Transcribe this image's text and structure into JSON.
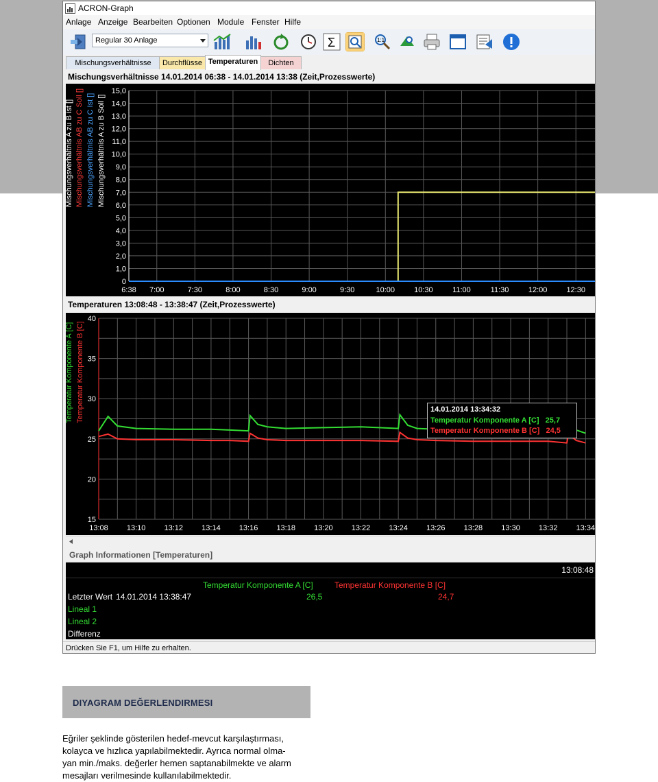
{
  "window": {
    "title": "ACRON-Graph"
  },
  "menu": [
    "Anlage",
    "Anzeige",
    "Bearbeiten",
    "Optionen",
    "Module",
    "Fenster",
    "Hilfe"
  ],
  "toolbar": {
    "select_value": "Regular 30 Anlage",
    "icons": [
      "layout-icon",
      "bar-chart-icon",
      "bar-chart-icon-2",
      "refresh-icon",
      "clock-icon",
      "sum-icon",
      "zoom-fit-icon",
      "zoom-icon",
      "zoom-in-icon",
      "print-icon",
      "window-icon",
      "export-icon",
      "info-icon"
    ]
  },
  "tabs": [
    "Mischungsverhältnisse",
    "Durchflüsse",
    "Temperaturen",
    "Dichten"
  ],
  "active_tab": "Temperaturen",
  "chart1": {
    "title": "Mischungsverhältnisse 14.01.2014 06:38 - 14.01.2014 13:38 (Zeit,Prozesswerte)",
    "axis_labels": [
      {
        "text": "Mischungsverhältnis A zu B ist []",
        "color": "#ffffff"
      },
      {
        "text": "Mischungsverhältnis AB zu C Soll []",
        "color": "#ff3b3b"
      },
      {
        "text": "Mischungsverhältnis AB zu C Ist []",
        "color": "#4aa3ff"
      },
      {
        "text": "Mischungsverhältnis A zu B Soll []",
        "color": "#ffffff"
      }
    ],
    "y_ticks": [
      "15,0",
      "14,0",
      "13,0",
      "12,0",
      "11,0",
      "10,0",
      "9,0",
      "8,0",
      "7,0",
      "6,0",
      "5,0",
      "4,0",
      "3,0",
      "2,0",
      "1,0",
      "0"
    ],
    "x_ticks": [
      "6:38",
      "7:00",
      "7:30",
      "8:00",
      "8:30",
      "9:00",
      "9:30",
      "10:00",
      "10:30",
      "11:00",
      "11:30",
      "12:00",
      "12:30"
    ]
  },
  "chart2": {
    "title": "Temperaturen 13:08:48 - 13:38:47 (Zeit,Prozesswerte)",
    "axis_labels": [
      {
        "text": "Temperatur Komponente A [C]",
        "color": "#33dd33"
      },
      {
        "text": "Temperatur Komponente B [C]",
        "color": "#ff3333"
      }
    ],
    "y_ticks": [
      "40",
      "35",
      "30",
      "25",
      "20",
      "15"
    ],
    "x_ticks": [
      "13:08",
      "13:10",
      "13:12",
      "13:14",
      "13:16",
      "13:18",
      "13:20",
      "13:22",
      "13:24",
      "13:26",
      "13:28",
      "13:30",
      "13:32",
      "13:34"
    ],
    "tooltip": {
      "time": "14.01.2014 13:34:32",
      "line_a": "Temperatur Komponente A [C]   25,7",
      "line_b": "Temperatur Komponente B [C]   24,5"
    }
  },
  "chart_data": [
    {
      "type": "line",
      "title": "Mischungsverhältnisse 14.01.2014 06:38 - 14.01.2014 13:38 (Zeit,Prozesswerte)",
      "xlabel": "",
      "ylim": [
        0,
        15
      ],
      "x": [
        "6:38",
        "10:10",
        "10:10",
        "12:45"
      ],
      "series": [
        {
          "name": "Mischungsverhältnis A zu B Soll []",
          "color": "#e8e870",
          "values": [
            0,
            0,
            7,
            7
          ]
        },
        {
          "name": "Mischungsverhältnis AB zu C Ist []",
          "color": "#2b8cff",
          "values": [
            0,
            0,
            0,
            0
          ]
        }
      ]
    },
    {
      "type": "line",
      "title": "Temperaturen 13:08:48 - 13:38:47 (Zeit,Prozesswerte)",
      "ylim": [
        15,
        40
      ],
      "x": [
        "13:08",
        "13:08:30",
        "13:09",
        "13:10",
        "13:12",
        "13:14",
        "13:15",
        "13:16",
        "13:16:05",
        "13:16:30",
        "13:17",
        "13:18",
        "13:20",
        "13:22",
        "13:24",
        "13:24:05",
        "13:24:30",
        "13:25",
        "13:26",
        "13:28",
        "13:30",
        "13:32",
        "13:33",
        "13:33:05",
        "13:33:30",
        "13:34"
      ],
      "series": [
        {
          "name": "Temperatur Komponente A [C]",
          "color": "#33dd33",
          "values": [
            26.0,
            27.8,
            26.6,
            26.3,
            26.2,
            26.2,
            26.1,
            26.0,
            27.9,
            26.8,
            26.5,
            26.3,
            26.4,
            26.5,
            26.3,
            28.0,
            26.7,
            26.3,
            26.2,
            26.1,
            26.1,
            26.0,
            25.8,
            27.6,
            26.1,
            25.7
          ]
        },
        {
          "name": "Temperatur Komponente B [C]",
          "color": "#ff3333",
          "values": [
            25.3,
            25.6,
            25.0,
            24.9,
            24.9,
            24.8,
            24.8,
            24.7,
            25.7,
            25.1,
            24.9,
            24.8,
            24.8,
            24.8,
            24.7,
            25.8,
            25.1,
            24.9,
            24.8,
            24.7,
            24.7,
            24.7,
            24.5,
            25.6,
            24.8,
            24.5
          ]
        }
      ]
    }
  ],
  "info": {
    "title": "Graph Informationen [Temperaturen]",
    "time": "13:08:48",
    "col_a": "Temperatur Komponente A [C]",
    "col_b": "Temperatur Komponente B [C]",
    "row_letzter": "Letzter Wert",
    "row_letzter_time": "14.01.2014 13:38:47",
    "val_a": "26,5",
    "val_b": "24,7",
    "row_lineal1": "Lineal 1",
    "row_lineal2": "Lineal 2",
    "row_differenz": "Differenz"
  },
  "status": "Drücken Sie F1, um Hilfe zu erhalten.",
  "caption": {
    "heading": "DIYAGRAM DEĞERLENDIRMESI",
    "lines": [
      "Eğriler şeklinde gösterilen hedef-mevcut karşılaştırması,",
      "kolayca ve hızlıca yapılabilmektedir. Ayrıca normal olma-",
      "yan min./maks. değerler hemen saptanabilmekte ve alarm",
      "mesajları verilmesinde kullanılabilmektedir."
    ]
  }
}
